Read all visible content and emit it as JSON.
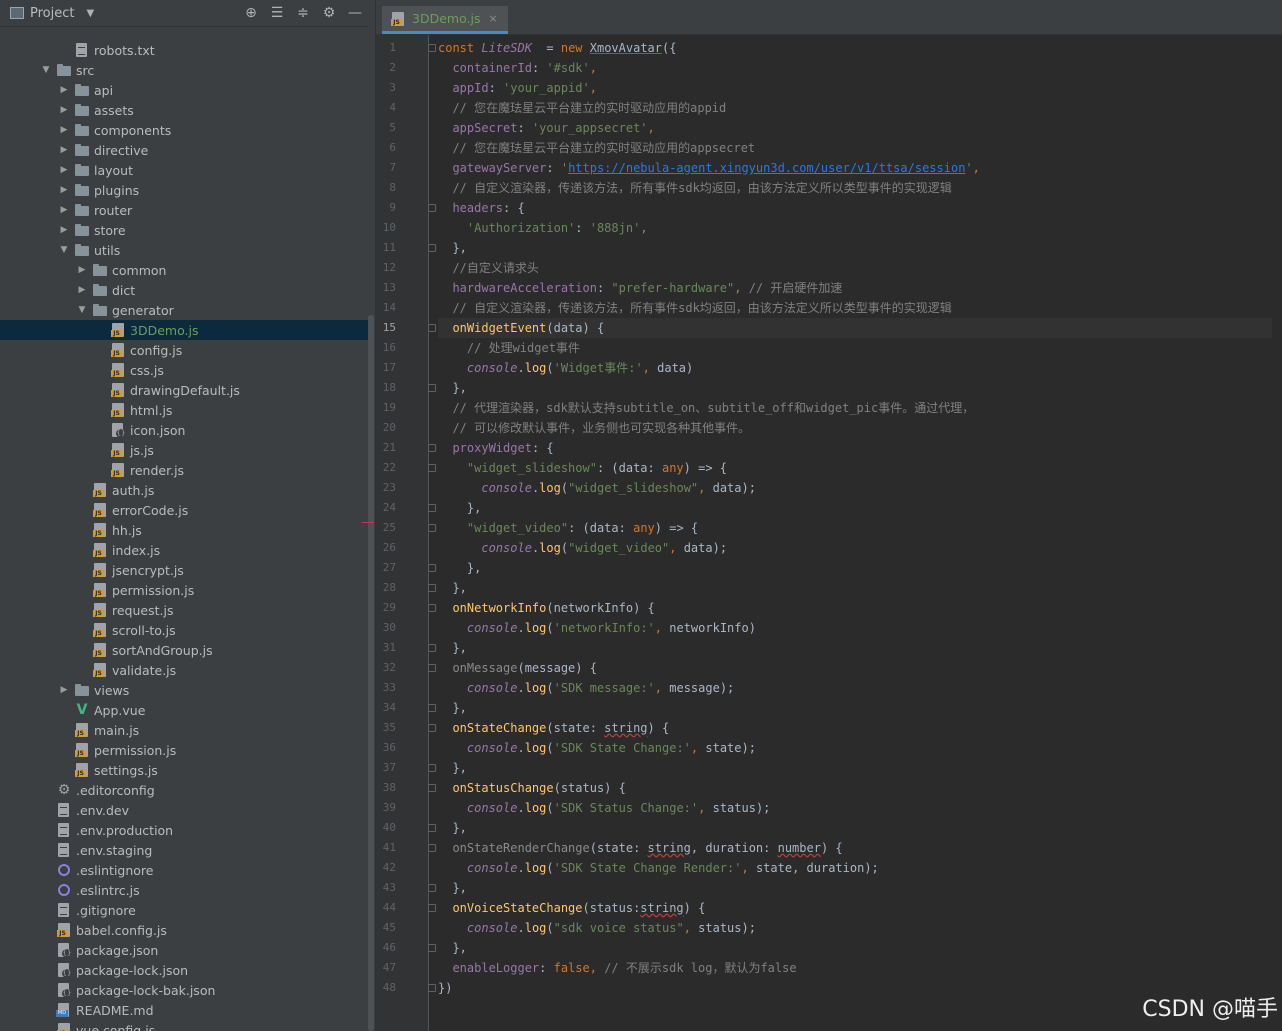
{
  "project_panel": {
    "title": "Project",
    "tools": [
      "locate-icon",
      "expand-all-icon",
      "collapse-all-icon",
      "settings-icon",
      "minimize-icon"
    ],
    "tree": [
      {
        "label": "robots.txt",
        "type": "file",
        "indent": 1,
        "twisty": ""
      },
      {
        "label": "src",
        "type": "folder",
        "indent": 0,
        "twisty": "open"
      },
      {
        "label": "api",
        "type": "folder",
        "indent": 1,
        "twisty": "closed"
      },
      {
        "label": "assets",
        "type": "folder",
        "indent": 1,
        "twisty": "closed"
      },
      {
        "label": "components",
        "type": "folder",
        "indent": 1,
        "twisty": "closed"
      },
      {
        "label": "directive",
        "type": "folder",
        "indent": 1,
        "twisty": "closed"
      },
      {
        "label": "layout",
        "type": "folder",
        "indent": 1,
        "twisty": "closed"
      },
      {
        "label": "plugins",
        "type": "folder",
        "indent": 1,
        "twisty": "closed"
      },
      {
        "label": "router",
        "type": "folder",
        "indent": 1,
        "twisty": "closed"
      },
      {
        "label": "store",
        "type": "folder",
        "indent": 1,
        "twisty": "closed"
      },
      {
        "label": "utils",
        "type": "folder",
        "indent": 1,
        "twisty": "open"
      },
      {
        "label": "common",
        "type": "folder",
        "indent": 2,
        "twisty": "closed"
      },
      {
        "label": "dict",
        "type": "folder",
        "indent": 2,
        "twisty": "closed"
      },
      {
        "label": "generator",
        "type": "folder",
        "indent": 2,
        "twisty": "open"
      },
      {
        "label": "3DDemo.js",
        "type": "js",
        "indent": 3,
        "twisty": "",
        "selected": true
      },
      {
        "label": "config.js",
        "type": "js",
        "indent": 3,
        "twisty": ""
      },
      {
        "label": "css.js",
        "type": "js",
        "indent": 3,
        "twisty": ""
      },
      {
        "label": "drawingDefault.js",
        "type": "js",
        "indent": 3,
        "twisty": ""
      },
      {
        "label": "html.js",
        "type": "js",
        "indent": 3,
        "twisty": ""
      },
      {
        "label": "icon.json",
        "type": "json",
        "indent": 3,
        "twisty": ""
      },
      {
        "label": "js.js",
        "type": "js",
        "indent": 3,
        "twisty": ""
      },
      {
        "label": "render.js",
        "type": "js",
        "indent": 3,
        "twisty": ""
      },
      {
        "label": "auth.js",
        "type": "js",
        "indent": 2,
        "twisty": ""
      },
      {
        "label": "errorCode.js",
        "type": "js",
        "indent": 2,
        "twisty": ""
      },
      {
        "label": "hh.js",
        "type": "js",
        "indent": 2,
        "twisty": ""
      },
      {
        "label": "index.js",
        "type": "js",
        "indent": 2,
        "twisty": ""
      },
      {
        "label": "jsencrypt.js",
        "type": "js",
        "indent": 2,
        "twisty": ""
      },
      {
        "label": "permission.js",
        "type": "js",
        "indent": 2,
        "twisty": ""
      },
      {
        "label": "request.js",
        "type": "js",
        "indent": 2,
        "twisty": ""
      },
      {
        "label": "scroll-to.js",
        "type": "js",
        "indent": 2,
        "twisty": ""
      },
      {
        "label": "sortAndGroup.js",
        "type": "js",
        "indent": 2,
        "twisty": ""
      },
      {
        "label": "validate.js",
        "type": "js",
        "indent": 2,
        "twisty": ""
      },
      {
        "label": "views",
        "type": "folder",
        "indent": 1,
        "twisty": "closed"
      },
      {
        "label": "App.vue",
        "type": "vue",
        "indent": 1,
        "twisty": ""
      },
      {
        "label": "main.js",
        "type": "js",
        "indent": 1,
        "twisty": ""
      },
      {
        "label": "permission.js",
        "type": "js",
        "indent": 1,
        "twisty": ""
      },
      {
        "label": "settings.js",
        "type": "js",
        "indent": 1,
        "twisty": ""
      },
      {
        "label": ".editorconfig",
        "type": "gear",
        "indent": 0,
        "twisty": ""
      },
      {
        "label": ".env.dev",
        "type": "file",
        "indent": 0,
        "twisty": ""
      },
      {
        "label": ".env.production",
        "type": "file",
        "indent": 0,
        "twisty": ""
      },
      {
        "label": ".env.staging",
        "type": "file",
        "indent": 0,
        "twisty": ""
      },
      {
        "label": ".eslintignore",
        "type": "ring",
        "indent": 0,
        "twisty": ""
      },
      {
        "label": ".eslintrc.js",
        "type": "ring",
        "indent": 0,
        "twisty": ""
      },
      {
        "label": ".gitignore",
        "type": "file",
        "indent": 0,
        "twisty": ""
      },
      {
        "label": "babel.config.js",
        "type": "js",
        "indent": 0,
        "twisty": ""
      },
      {
        "label": "package.json",
        "type": "json",
        "indent": 0,
        "twisty": ""
      },
      {
        "label": "package-lock.json",
        "type": "json",
        "indent": 0,
        "twisty": ""
      },
      {
        "label": "package-lock-bak.json",
        "type": "json",
        "indent": 0,
        "twisty": ""
      },
      {
        "label": "README.md",
        "type": "md",
        "indent": 0,
        "twisty": ""
      },
      {
        "label": "vue.config.js",
        "type": "js",
        "indent": 0,
        "twisty": ""
      }
    ]
  },
  "editor": {
    "tab": {
      "label": "3DDemo.js",
      "close": "×"
    },
    "current_line": 15,
    "lines": [
      [
        [
          "kw",
          "const "
        ],
        [
          "prop it",
          "LiteSDK"
        ],
        [
          "",
          "  = "
        ],
        [
          "kw",
          "new "
        ],
        [
          "cls",
          "XmovAvatar"
        ],
        [
          "",
          "({"
        ]
      ],
      [
        [
          "",
          "  "
        ],
        [
          "prop",
          "containerId"
        ],
        [
          "",
          ": "
        ],
        [
          "str",
          "'#sdk'"
        ],
        [
          "kw",
          ","
        ]
      ],
      [
        [
          "",
          "  "
        ],
        [
          "prop",
          "appId"
        ],
        [
          "",
          ": "
        ],
        [
          "str",
          "'your_appid'"
        ],
        [
          "kw",
          ","
        ]
      ],
      [
        [
          "",
          "  "
        ],
        [
          "cmt",
          "// 您在魔珐星云平台建立的实时驱动应用的appid"
        ]
      ],
      [
        [
          "",
          "  "
        ],
        [
          "prop",
          "appSecret"
        ],
        [
          "",
          ": "
        ],
        [
          "str",
          "'your_appsecret'"
        ],
        [
          "kw",
          ","
        ]
      ],
      [
        [
          "",
          "  "
        ],
        [
          "cmt",
          "// 您在魔珐星云平台建立的实时驱动应用的appsecret"
        ]
      ],
      [
        [
          "",
          "  "
        ],
        [
          "prop",
          "gatewayServer"
        ],
        [
          "",
          ": "
        ],
        [
          "str",
          "'"
        ],
        [
          "link",
          "https://nebula-agent.xingyun3d.com/user/v1/ttsa/session"
        ],
        [
          "str",
          "'"
        ],
        [
          "kw",
          ","
        ]
      ],
      [
        [
          "",
          "  "
        ],
        [
          "cmt",
          "// 自定义渲染器，传递该方法，所有事件sdk均返回，由该方法定义所以类型事件的实现逻辑"
        ]
      ],
      [
        [
          "",
          "  "
        ],
        [
          "prop",
          "headers"
        ],
        [
          "",
          ": {"
        ]
      ],
      [
        [
          "",
          "    "
        ],
        [
          "str",
          "'Authorization'"
        ],
        [
          "",
          ": "
        ],
        [
          "str",
          "'888jn'"
        ],
        [
          "kw",
          ","
        ]
      ],
      [
        [
          "",
          "  },"
        ]
      ],
      [
        [
          "",
          "  "
        ],
        [
          "cmt",
          "//自定义请求头"
        ]
      ],
      [
        [
          "",
          "  "
        ],
        [
          "prop",
          "hardwareAcceleration"
        ],
        [
          "",
          ": "
        ],
        [
          "str",
          "\"prefer-hardware\""
        ],
        [
          "kw",
          ","
        ],
        [
          "cmt",
          " // 开启硬件加速"
        ]
      ],
      [
        [
          "",
          "  "
        ],
        [
          "cmt",
          "// 自定义渲染器，传递该方法，所有事件sdk均返回，由该方法定义所以类型事件的实现逻辑"
        ]
      ],
      [
        [
          "",
          "  "
        ],
        [
          "fn",
          "onWidgetEvent"
        ],
        [
          "",
          "(data) {"
        ]
      ],
      [
        [
          "",
          "    "
        ],
        [
          "cmt",
          "// 处理widget事件"
        ]
      ],
      [
        [
          "",
          "    "
        ],
        [
          "prop it",
          "console"
        ],
        [
          "",
          "."
        ],
        [
          "fn",
          "log"
        ],
        [
          "",
          "("
        ],
        [
          "str",
          "'Widget事件:'"
        ],
        [
          "kw",
          ","
        ],
        [
          "",
          " data)"
        ]
      ],
      [
        [
          "",
          "  },"
        ]
      ],
      [
        [
          "",
          "  "
        ],
        [
          "cmt",
          "// 代理渲染器，sdk默认支持subtitle_on、subtitle_off和widget_pic事件。通过代理，"
        ]
      ],
      [
        [
          "",
          "  "
        ],
        [
          "cmt",
          "// 可以修改默认事件，业务侧也可实现各种其他事件。"
        ]
      ],
      [
        [
          "",
          "  "
        ],
        [
          "prop",
          "proxyWidget"
        ],
        [
          "",
          ": {"
        ]
      ],
      [
        [
          "",
          "    "
        ],
        [
          "str",
          "\"widget_slideshow\""
        ],
        [
          "",
          ": (data: "
        ],
        [
          "kw",
          "any"
        ],
        [
          "",
          ") => {"
        ]
      ],
      [
        [
          "",
          "      "
        ],
        [
          "prop it",
          "console"
        ],
        [
          "",
          "."
        ],
        [
          "fn",
          "log"
        ],
        [
          "",
          "("
        ],
        [
          "str",
          "\"widget_slideshow\""
        ],
        [
          "kw",
          ","
        ],
        [
          "",
          " data);"
        ]
      ],
      [
        [
          "",
          "    },"
        ]
      ],
      [
        [
          "",
          "    "
        ],
        [
          "str",
          "\"widget_video\""
        ],
        [
          "",
          ": (data: "
        ],
        [
          "kw",
          "any"
        ],
        [
          "",
          ") => {"
        ]
      ],
      [
        [
          "",
          "      "
        ],
        [
          "prop it",
          "console"
        ],
        [
          "",
          "."
        ],
        [
          "fn",
          "log"
        ],
        [
          "",
          "("
        ],
        [
          "str",
          "\"widget_video\""
        ],
        [
          "kw",
          ","
        ],
        [
          "",
          " data);"
        ]
      ],
      [
        [
          "",
          "    },"
        ]
      ],
      [
        [
          "",
          "  },"
        ]
      ],
      [
        [
          "",
          "  "
        ],
        [
          "fn",
          "onNetworkInfo"
        ],
        [
          "",
          "(networkInfo) {"
        ]
      ],
      [
        [
          "",
          "    "
        ],
        [
          "prop it",
          "console"
        ],
        [
          "",
          "."
        ],
        [
          "fn",
          "log"
        ],
        [
          "",
          "("
        ],
        [
          "str",
          "'networkInfo:'"
        ],
        [
          "kw",
          ","
        ],
        [
          "",
          " networkInfo)"
        ]
      ],
      [
        [
          "",
          "  },"
        ]
      ],
      [
        [
          "",
          "  "
        ],
        [
          "dim",
          "onMessage"
        ],
        [
          "",
          "(message) {"
        ]
      ],
      [
        [
          "",
          "    "
        ],
        [
          "prop it",
          "console"
        ],
        [
          "",
          "."
        ],
        [
          "fn",
          "log"
        ],
        [
          "",
          "("
        ],
        [
          "str",
          "'SDK message:'"
        ],
        [
          "kw",
          ","
        ],
        [
          "",
          " message);"
        ]
      ],
      [
        [
          "",
          "  },"
        ]
      ],
      [
        [
          "",
          "  "
        ],
        [
          "fn",
          "onStateChange"
        ],
        [
          "",
          "(state: "
        ],
        [
          "under",
          "string"
        ],
        [
          "",
          ") {"
        ]
      ],
      [
        [
          "",
          "    "
        ],
        [
          "prop it",
          "console"
        ],
        [
          "",
          "."
        ],
        [
          "fn",
          "log"
        ],
        [
          "",
          "("
        ],
        [
          "str",
          "'SDK State Change:'"
        ],
        [
          "kw",
          ","
        ],
        [
          "",
          " state);"
        ]
      ],
      [
        [
          "",
          "  },"
        ]
      ],
      [
        [
          "",
          "  "
        ],
        [
          "fn",
          "onStatusChange"
        ],
        [
          "",
          "(status) {"
        ]
      ],
      [
        [
          "",
          "    "
        ],
        [
          "prop it",
          "console"
        ],
        [
          "",
          "."
        ],
        [
          "fn",
          "log"
        ],
        [
          "",
          "("
        ],
        [
          "str",
          "'SDK Status Change:'"
        ],
        [
          "kw",
          ","
        ],
        [
          "",
          " status);"
        ]
      ],
      [
        [
          "",
          "  },"
        ]
      ],
      [
        [
          "",
          "  "
        ],
        [
          "dim",
          "onStateRenderChange"
        ],
        [
          "",
          "(state: "
        ],
        [
          "under",
          "string"
        ],
        [
          "",
          ", duration: "
        ],
        [
          "under",
          "number"
        ],
        [
          "",
          ") {"
        ]
      ],
      [
        [
          "",
          "    "
        ],
        [
          "prop it",
          "console"
        ],
        [
          "",
          "."
        ],
        [
          "fn",
          "log"
        ],
        [
          "",
          "("
        ],
        [
          "str",
          "'SDK State Change Render:'"
        ],
        [
          "kw",
          ","
        ],
        [
          "",
          " state, duration);"
        ]
      ],
      [
        [
          "",
          "  },"
        ]
      ],
      [
        [
          "",
          "  "
        ],
        [
          "fn",
          "onVoiceStateChange"
        ],
        [
          "",
          "(status:"
        ],
        [
          "under",
          "string"
        ],
        [
          "",
          ") {"
        ]
      ],
      [
        [
          "",
          "    "
        ],
        [
          "prop it",
          "console"
        ],
        [
          "",
          "."
        ],
        [
          "fn",
          "log"
        ],
        [
          "",
          "("
        ],
        [
          "str",
          "\"sdk voice status\""
        ],
        [
          "kw",
          ","
        ],
        [
          "",
          " status);"
        ]
      ],
      [
        [
          "",
          "  },"
        ]
      ],
      [
        [
          "",
          "  "
        ],
        [
          "prop",
          "enableLogger"
        ],
        [
          "",
          ": "
        ],
        [
          "kw",
          "false"
        ],
        [
          "kw",
          ","
        ],
        [
          "cmt",
          " // 不展示sdk log，默认为false"
        ]
      ],
      [
        [
          "",
          "})"
        ]
      ]
    ]
  },
  "watermark": "CSDN @喵手"
}
